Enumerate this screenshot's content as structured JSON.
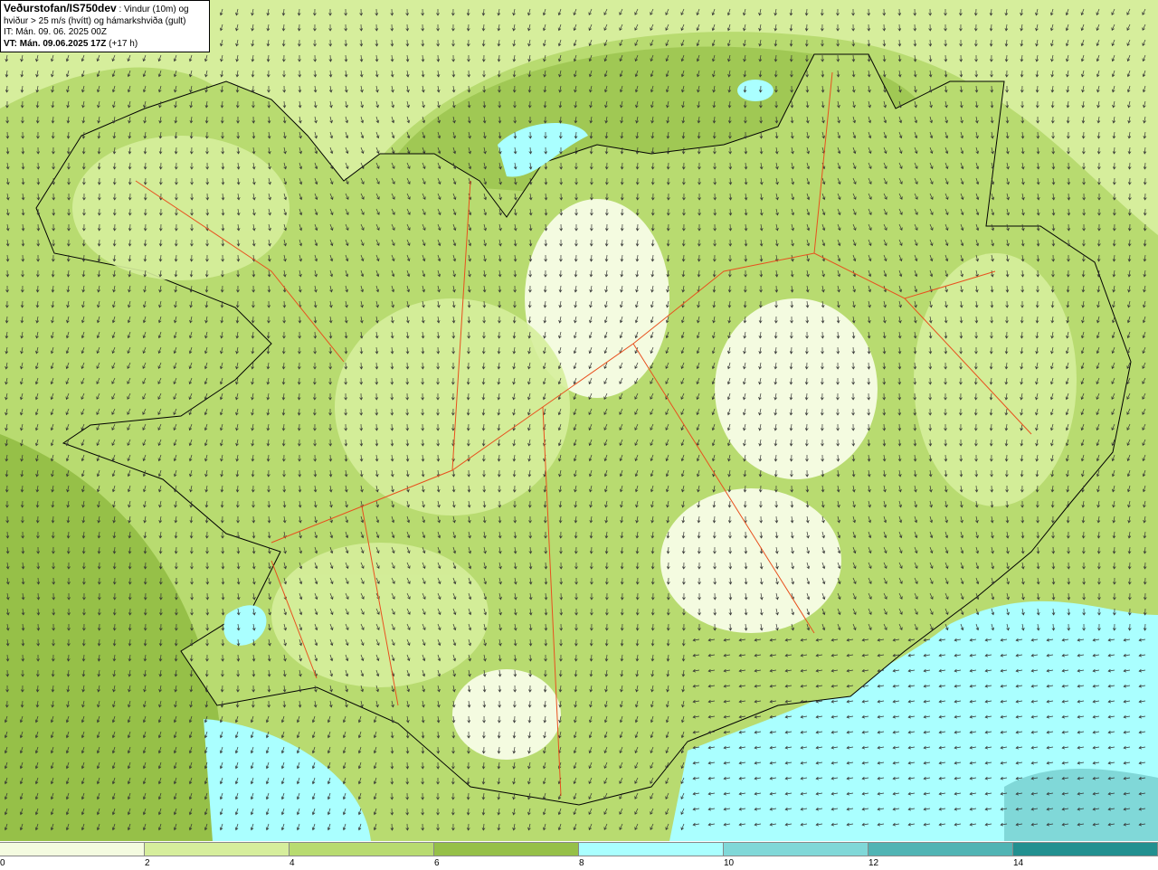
{
  "header": {
    "source": "Veðurstofan/IS750dev",
    "description_line1": " : Vindur (10m) og",
    "description_line2": "hviður > 25 m/s (hvítt) og hámarkshviða (gult)",
    "initial_time": "IT: Mán. 09. 06. 2025 00Z",
    "valid_time": "VT: Mán. 09.06.2025 17Z",
    "lead_time": " (+17 h)"
  },
  "legend": {
    "unit_hint": "m/s",
    "ticks": [
      "0",
      "2",
      "4",
      "6",
      "8",
      "10",
      "12",
      "14"
    ],
    "colors": [
      "#f4fbe0",
      "#d6ee9c",
      "#b8db70",
      "#96c048",
      "#aaffff",
      "#80d8d8",
      "#50b4b4",
      "#229090"
    ]
  },
  "map": {
    "region": "Iceland",
    "layers": [
      "wind-speed-fill",
      "wind-arrows",
      "coastline",
      "roads"
    ],
    "road_color": "#e8501e",
    "coast_color": "#000000"
  }
}
